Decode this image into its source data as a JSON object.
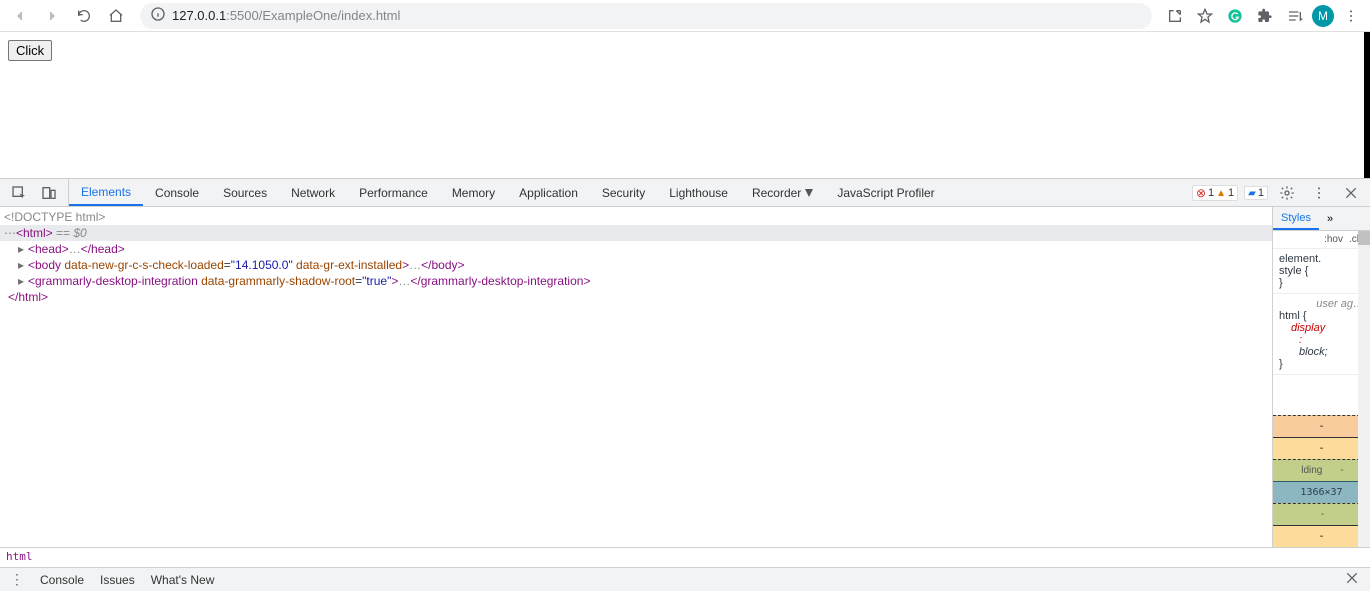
{
  "browser": {
    "url_host": "127.0.0.1",
    "url_path": ":5500/ExampleOne/index.html",
    "avatar_letter": "M"
  },
  "page": {
    "click_button": "Click"
  },
  "devtools": {
    "tabs": [
      "Elements",
      "Console",
      "Sources",
      "Network",
      "Performance",
      "Memory",
      "Application",
      "Security",
      "Lighthouse",
      "Recorder",
      "JavaScript Profiler"
    ],
    "active_tab": 0,
    "errors": "1",
    "warnings": "1",
    "messages": "1"
  },
  "elements": {
    "l1": "<!DOCTYPE html>",
    "l2a": "<html>",
    "l2b": " == ",
    "l2c": "$0",
    "l3a": "<head>",
    "l3b": "…",
    "l3c": "</head>",
    "l4a": "<body ",
    "l4_attr1": "data-new-gr-c-s-check-loaded",
    "l4_val1": "\"14.1050.0\"",
    "l4_attr2": "data-gr-ext-installed",
    "l4b": ">",
    "l4c": "…",
    "l4d": "</body>",
    "l5a": "<grammarly-desktop-integration ",
    "l5_attr1": "data-grammarly-shadow-root",
    "l5_val1": "\"true\"",
    "l5b": ">",
    "l5c": "…",
    "l5d": "</grammarly-desktop-integration>",
    "l6": "</html>"
  },
  "styles": {
    "tab_label": "Styles",
    "hov": ":hov",
    "cls": ".cls",
    "element_style_l1": "element.",
    "element_style_l2": "style {",
    "element_style_l3": "}",
    "user_agent": "user ag…",
    "html_rule": "html {",
    "display_prop": "display",
    "colon": ":",
    "display_val": "block;",
    "close_brace": "}",
    "padding_label": "lding",
    "content_dims": "1366×37",
    "dash": "-"
  },
  "crumb": "html",
  "drawer": {
    "t1": "Console",
    "t2": "Issues",
    "t3": "What's New"
  }
}
